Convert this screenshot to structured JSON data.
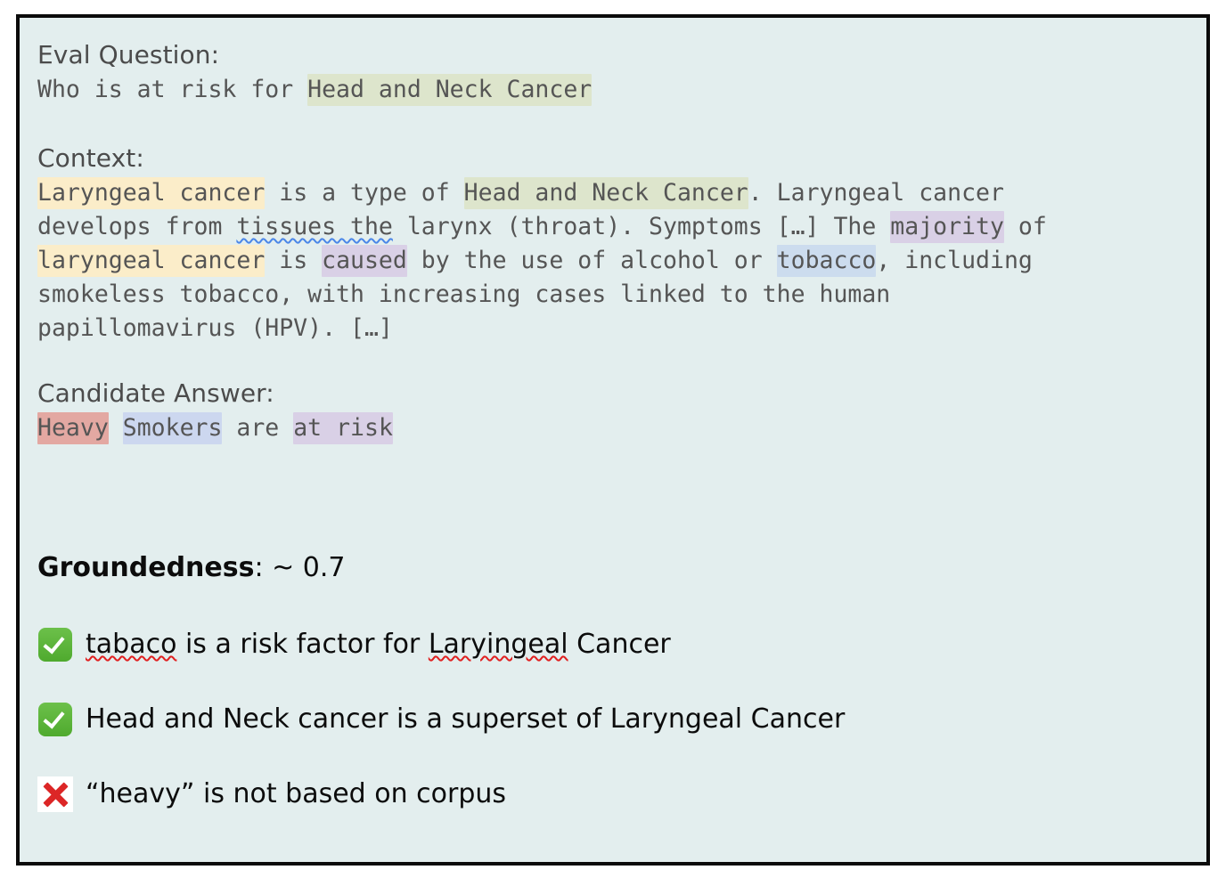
{
  "panel": {
    "background_color": "#e3eeee",
    "border_color": "#0b0b0b"
  },
  "question": {
    "label": "Eval Question:",
    "prefix": "Who is at risk for ",
    "highlight_green": "Head and Neck Cancer"
  },
  "context": {
    "label": "Context:",
    "seg_1_yellow": "Laryngeal cancer",
    "seg_2": " is a type of ",
    "seg_3_green": "Head and Neck Cancer",
    "seg_4": ". Laryngeal cancer\ndevelops from ",
    "seg_5_squiggle": "tissues the",
    "seg_6": " larynx (throat). Symptoms […] The ",
    "seg_7_purple": "majority",
    "seg_8": " of\n",
    "seg_9_yellow": "laryngeal cancer",
    "seg_10": " is ",
    "seg_11_purple": "caused",
    "seg_12": " by the use of alcohol or ",
    "seg_13_blue": "tobacco",
    "seg_14": ", including\nsmokeless tobacco, with increasing cases linked to the human\npapillomavirus (HPV). […]"
  },
  "answer": {
    "label": "Candidate Answer:",
    "seg_1_red": "Heavy",
    "seg_2": " ",
    "seg_3_blue": "Smokers",
    "seg_4": " are ",
    "seg_5_purple": "at risk"
  },
  "groundedness": {
    "label": "Groundedness",
    "value": ": ~ 0.7"
  },
  "checklist": [
    {
      "icon": "check-mark-button-icon",
      "status": "pass",
      "pre": "",
      "misspelled_1": "tabaco",
      "mid": " is a risk factor for ",
      "misspelled_2": "Laryingeal",
      "post": " Cancer"
    },
    {
      "icon": "check-mark-button-icon",
      "status": "pass",
      "text": "Head and Neck cancer is a superset of Laryngeal Cancer"
    },
    {
      "icon": "cross-mark-icon",
      "status": "fail",
      "text": "“heavy” is not based on corpus"
    }
  ],
  "colors": {
    "highlight_green": "#dde5cc",
    "highlight_yellow": "#fbedc9",
    "highlight_purple": "#d9d0e6",
    "highlight_blue": "#ccdcee",
    "highlight_blue_answer": "#ccd7ef",
    "highlight_red": "#e3a8a2",
    "spellcheck_red": "#e02020",
    "grammar_blue": "#4a86e8",
    "pass_green": "#4faa2e",
    "fail_red": "#dc2626"
  }
}
